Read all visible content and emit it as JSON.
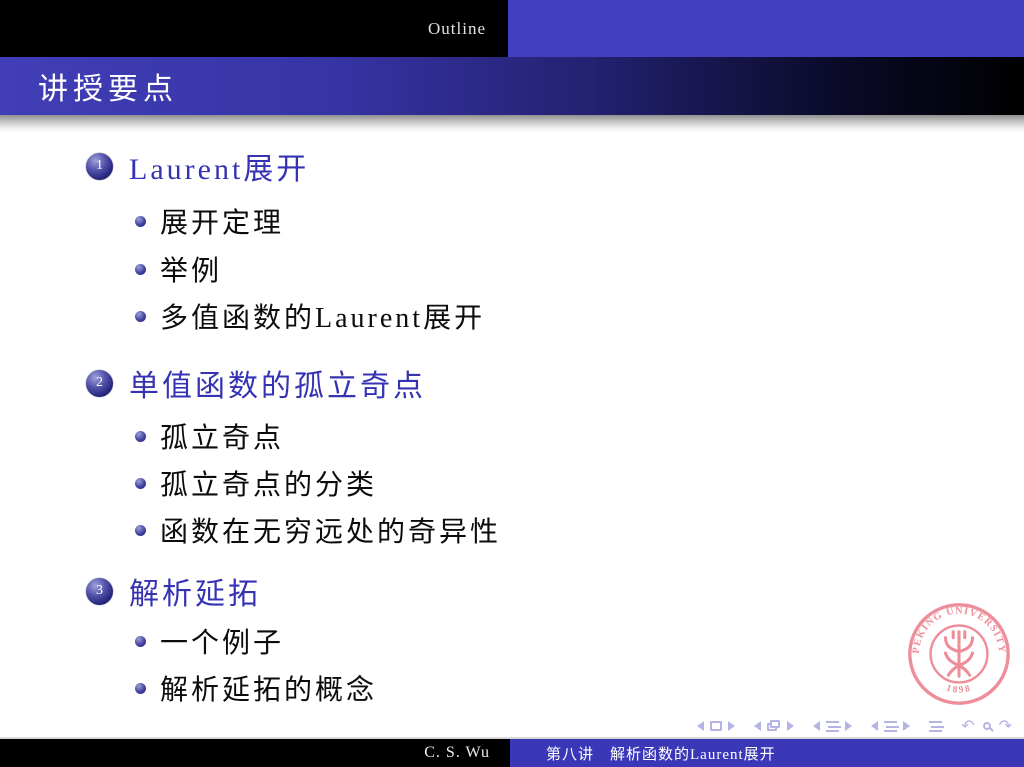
{
  "header": {
    "outline_label": "Outline"
  },
  "frame_title": "讲授要点",
  "toc": {
    "sections": [
      {
        "number": "1",
        "title": "Laurent展开",
        "subitems": [
          "展开定理",
          "举例",
          "多值函数的Laurent展开"
        ]
      },
      {
        "number": "2",
        "title": "单值函数的孤立奇点",
        "subitems": [
          "孤立奇点",
          "孤立奇点的分类",
          "函数在无穷远处的奇异性"
        ]
      },
      {
        "number": "3",
        "title": "解析延拓",
        "subitems": [
          "一个例子",
          "解析延拓的概念"
        ]
      }
    ]
  },
  "footer": {
    "author": "C. S. Wu",
    "lecture_title": "第八讲　解析函数的Laurent展开"
  },
  "logo": {
    "university_text": "PEKING UNIVERSITY",
    "year": "1898",
    "color": "#ee8e9a"
  },
  "nav": {
    "glyphs": {
      "back": "↶",
      "forward": "↷"
    }
  },
  "colors": {
    "structure_blue": "#3533b3",
    "header_blue": "#423fc0",
    "footer_blue": "#3b38b8",
    "nav_icon": "#b5b5e5",
    "seal_pink": "#ee8e9a"
  }
}
